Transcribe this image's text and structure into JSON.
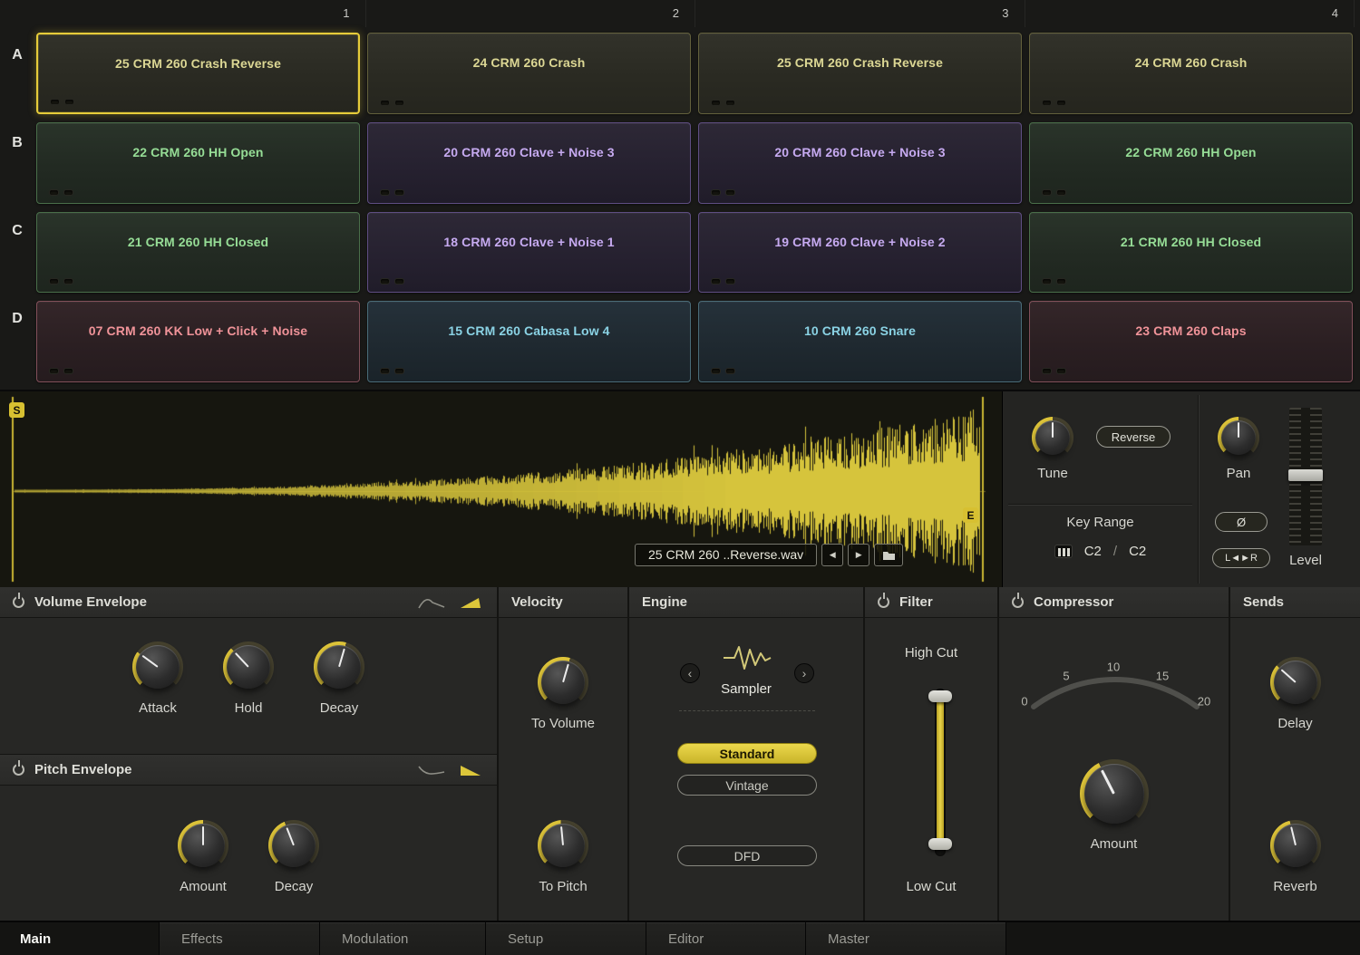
{
  "grid": {
    "columns": [
      "1",
      "2",
      "3",
      "4"
    ],
    "rows": [
      "A",
      "B",
      "C",
      "D"
    ],
    "cells": [
      {
        "label": "25 CRM 260 Crash Reverse",
        "theme": "yellow",
        "selected": true
      },
      {
        "label": "24 CRM 260 Crash",
        "theme": "yellow",
        "selected": false
      },
      {
        "label": "25 CRM 260 Crash Reverse",
        "theme": "yellow",
        "selected": false
      },
      {
        "label": "24 CRM 260 Crash",
        "theme": "yellow",
        "selected": false
      },
      {
        "label": "22 CRM 260 HH Open",
        "theme": "green",
        "selected": false
      },
      {
        "label": "20 CRM 260 Clave + Noise 3",
        "theme": "purple",
        "selected": false
      },
      {
        "label": "20 CRM 260 Clave + Noise 3",
        "theme": "purple",
        "selected": false
      },
      {
        "label": "22 CRM 260 HH Open",
        "theme": "green",
        "selected": false
      },
      {
        "label": "21 CRM 260 HH Closed",
        "theme": "green",
        "selected": false
      },
      {
        "label": "18 CRM 260 Clave + Noise 1",
        "theme": "purple",
        "selected": false
      },
      {
        "label": "19 CRM 260 Clave + Noise 2",
        "theme": "purple",
        "selected": false
      },
      {
        "label": "21 CRM 260 HH Closed",
        "theme": "green",
        "selected": false
      },
      {
        "label": "07 CRM 260 KK Low + Click + Noise",
        "theme": "red",
        "selected": false
      },
      {
        "label": "15 CRM 260 Cabasa Low 4",
        "theme": "cyan",
        "selected": false
      },
      {
        "label": "10 CRM 260 Snare",
        "theme": "cyan",
        "selected": false
      },
      {
        "label": "23 CRM 260 Claps",
        "theme": "red",
        "selected": false
      }
    ]
  },
  "waveform": {
    "start_marker": "S",
    "end_marker": "E",
    "file_name": "25 CRM 260 ..Reverse.wav",
    "prev_icon": "◀",
    "next_icon": "▶"
  },
  "sample": {
    "tune_label": "Tune",
    "reverse_button": "Reverse",
    "pan_label": "Pan",
    "level_label": "Level",
    "key_range_label": "Key Range",
    "key_low": "C2",
    "key_sep": "/",
    "key_high": "C2",
    "phase_button": "Ø",
    "swap_button": "L◄►R"
  },
  "panels": {
    "volume_envelope": {
      "title": "Volume Envelope",
      "knobs": [
        "Attack",
        "Hold",
        "Decay"
      ]
    },
    "pitch_envelope": {
      "title": "Pitch Envelope",
      "knobs": [
        "Amount",
        "Decay"
      ]
    },
    "velocity": {
      "title": "Velocity",
      "knobs": [
        "To Volume",
        "To Pitch"
      ]
    },
    "engine": {
      "title": "Engine",
      "mode": "Sampler",
      "prev_icon": "‹",
      "next_icon": "›",
      "standard": "Standard",
      "vintage": "Vintage",
      "dfd": "DFD"
    },
    "filter": {
      "title": "Filter",
      "high": "High Cut",
      "low": "Low Cut"
    },
    "compressor": {
      "title": "Compressor",
      "scale": [
        "0",
        "5",
        "10",
        "15",
        "20"
      ],
      "knob": "Amount"
    },
    "sends": {
      "title": "Sends",
      "knobs": [
        "Delay",
        "Reverb"
      ]
    }
  },
  "tabs": [
    {
      "label": "Main",
      "active": true
    },
    {
      "label": "Effects",
      "active": false
    },
    {
      "label": "Modulation",
      "active": false
    },
    {
      "label": "Setup",
      "active": false
    },
    {
      "label": "Editor",
      "active": false
    },
    {
      "label": "Master",
      "active": false
    }
  ],
  "colors": {
    "accent": "#e0c63a",
    "green": "#96dd96",
    "purple": "#c6aaf0",
    "red": "#f09399",
    "cyan": "#8ad2e4",
    "yellow": "#dcd794"
  }
}
